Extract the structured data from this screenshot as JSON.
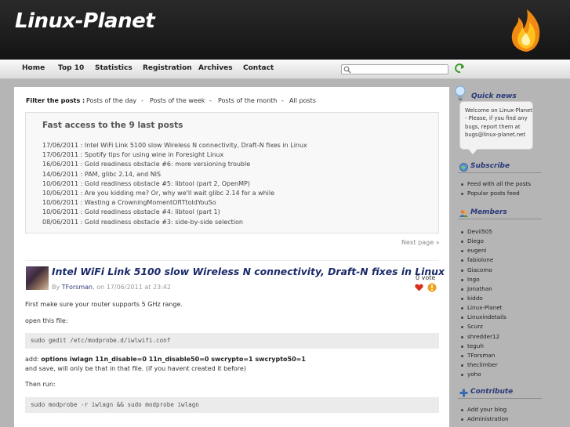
{
  "site": {
    "title": "Linux-Planet"
  },
  "nav": {
    "items": [
      "Home",
      "Top 10",
      "Statistics",
      "Registration",
      "Archives",
      "Contact"
    ]
  },
  "search": {
    "placeholder": ""
  },
  "filter": {
    "label": "Filter the posts :",
    "options": [
      "Posts of the day",
      "Posts of the week",
      "Posts of the month",
      "All posts"
    ],
    "separator": "-"
  },
  "fast_access": {
    "title": "Fast access to the 9 last posts",
    "items": [
      "17/06/2011 : Intel WiFi Link 5100 slow Wireless N connectivity, Draft-N fixes in Linux",
      "17/06/2011 : Spotify tips for using wine in Foresight Linux",
      "16/06/2011 : Gold readiness obstacle #6: more versioning trouble",
      "14/06/2011 : PAM, glibc 2.14, and NIS",
      "10/06/2011 : Gold readiness obstacle #5: libtool (part 2, OpenMP)",
      "10/06/2011 : Are you kidding me? Or, why we'll wait glibc 2.14 for a while",
      "10/06/2011 : Wasting a CrowningMomentOfITtoldYouSo",
      "10/06/2011 : Gold readiness obstacle #4: libtool (part 1)",
      "08/06/2011 : Gold readiness obstacle #3: side-by-side selection"
    ]
  },
  "next_page": "Next page »",
  "post": {
    "title": "Intel WiFi Link 5100 slow Wireless N connectivity, Draft-N fixes in Linux",
    "by": "By",
    "author": "TForsman",
    "date": ", on 17/06/2011 at 23:42",
    "votes": "0 vote",
    "line1": "First make sure your router supports 5 GHz range.",
    "line2": "open this file:",
    "code1": "sudo gedit /etc/modprobe.d/iwlwifi.conf",
    "line3_prefix": "add: ",
    "line3_bold": "options iwlagn 11n_disable=0 11n_disable50=0 swcrypto=1 swcrypto50=1",
    "line4": "and save, will only be that in that file. (if you havent created it before)",
    "line5": "Then run:",
    "code2": "sudo modprobe -r iwlagn && sudo modprobe iwlagn"
  },
  "sidebar": {
    "quick_news": {
      "title": "Quick news",
      "text": "Welcome on Linux-Planet - Please, if you find any bugs, report them at bugs@linux-planet.net"
    },
    "subscribe": {
      "title": "Subscribe",
      "items": [
        "Feed with all the posts",
        "Popular posts feed"
      ]
    },
    "members": {
      "title": "Members",
      "items": [
        "Devil505",
        "Diego",
        "eugeni",
        "fabiolone",
        "Giacomo",
        "Ingo",
        "Jonathan",
        "kiddo",
        "Linux-Planet",
        "Linuxindetails",
        "Scurz",
        "shredder12",
        "teguh",
        "TForsman",
        "theclimber",
        "yoho"
      ]
    },
    "contribute": {
      "title": "Contribute",
      "items": [
        "Add your blog",
        "Administration"
      ]
    }
  },
  "colors": {
    "link": "#2a3a7a",
    "header_bg": "#1c1c1c",
    "page_bg": "#b5b5b5"
  }
}
